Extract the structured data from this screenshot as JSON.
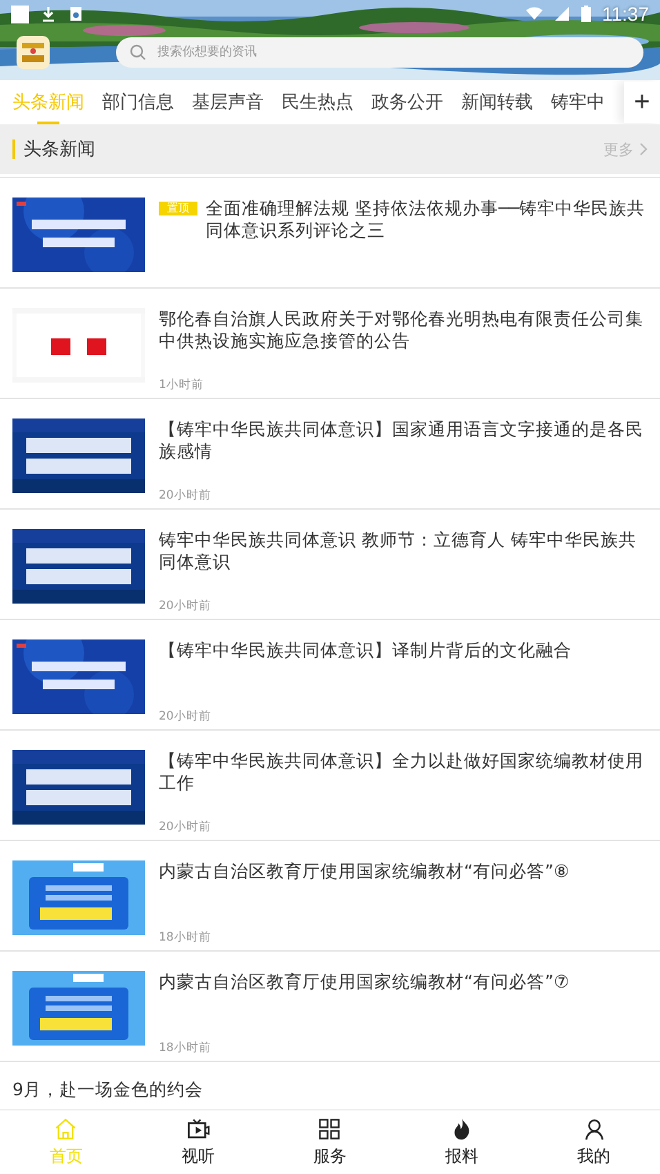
{
  "status_bar": {
    "time": "11:37"
  },
  "search": {
    "placeholder": "搜索你想要的资讯"
  },
  "tabs": [
    {
      "label": "头条新闻",
      "selected": true
    },
    {
      "label": "部门信息",
      "selected": false
    },
    {
      "label": "基层声音",
      "selected": false
    },
    {
      "label": "民生热点",
      "selected": false
    },
    {
      "label": "政务公开",
      "selected": false
    },
    {
      "label": "新闻转载",
      "selected": false
    },
    {
      "label": "铸牢中",
      "selected": false
    }
  ],
  "add_tab": "+",
  "section": {
    "title": "头条新闻",
    "more": "更多"
  },
  "news": [
    {
      "kind": "banner",
      "tag": "置顶",
      "title": "全面准确理解法规  坚持依法依规办事──铸牢中华民族共同体意识系列评论之三"
    },
    {
      "kind": "notice",
      "title": "鄂伦春自治旗人民政府关于对鄂伦春光明热电有限责任公司集中供热设施实施应急接管的公告",
      "time": "1小时前"
    },
    {
      "kind": "important",
      "title": "【铸牢中华民族共同体意识】国家通用语言文字接通的是各民族感情",
      "time": "20小时前"
    },
    {
      "kind": "important",
      "title": "铸牢中华民族共同体意识  教师节：立德育人  铸牢中华民族共同体意识",
      "time": "20小时前"
    },
    {
      "kind": "banner",
      "title": "【铸牢中华民族共同体意识】译制片背后的文化融合",
      "time": "20小时前"
    },
    {
      "kind": "important",
      "title": "【铸牢中华民族共同体意识】全力以赴做好国家统编教材使用工作",
      "time": "20小时前"
    },
    {
      "kind": "qa",
      "title": "内蒙古自治区教育厅使用国家统编教材“有问必答”⑧",
      "time": "18小时前"
    },
    {
      "kind": "qa",
      "title": "内蒙古自治区教育厅使用国家统编教材“有问必答”⑦",
      "time": "18小时前"
    },
    {
      "kind": "text",
      "title": "9月，赴一场金色的约会"
    }
  ],
  "bottom_nav": [
    {
      "label": "首页",
      "selected": true
    },
    {
      "label": "视听",
      "selected": false
    },
    {
      "label": "服务",
      "selected": false
    },
    {
      "label": "报料",
      "selected": false
    },
    {
      "label": "我的",
      "selected": false
    }
  ]
}
